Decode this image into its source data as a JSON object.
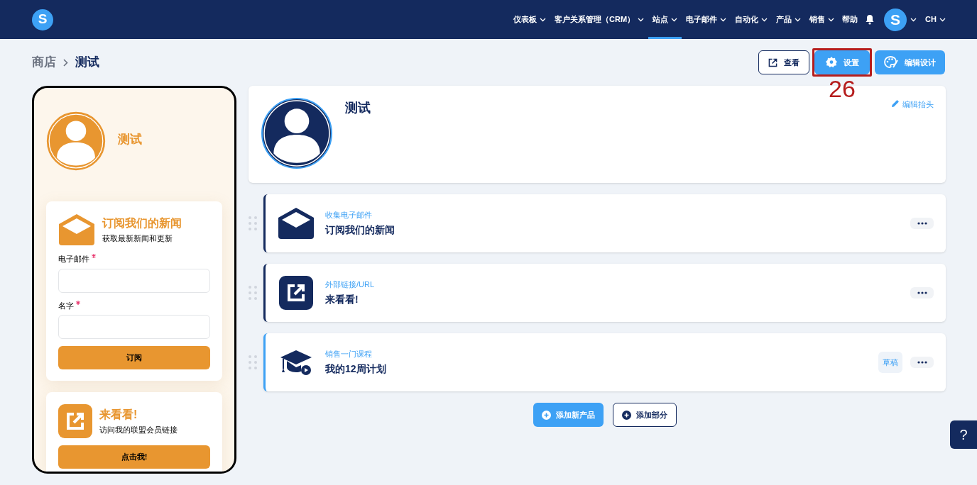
{
  "logo": "S",
  "nav": [
    {
      "label": "仪表板",
      "selected": false
    },
    {
      "label": "客户关系管理（CRM）",
      "selected": false
    },
    {
      "label": "站点",
      "selected": true
    },
    {
      "label": "电子邮件",
      "selected": false
    },
    {
      "label": "自动化",
      "selected": false
    },
    {
      "label": "产品",
      "selected": false
    },
    {
      "label": "销售",
      "selected": false
    }
  ],
  "help_link": "帮助",
  "avatar": "S",
  "language": "CH",
  "breadcrumb": [
    "商店",
    "测试"
  ],
  "actions": [
    {
      "kind": "view",
      "label": "查看"
    },
    {
      "kind": "settings",
      "label": "设置"
    },
    {
      "kind": "design",
      "label": "编辑设计"
    }
  ],
  "annotation": {
    "label": "26"
  },
  "preview": {
    "name": "测试",
    "blocks": [
      {
        "kind": "form",
        "title": "订阅我们的新闻",
        "subtitle": "获取最新新闻和更新",
        "fields": [
          {
            "label": "电子邮件",
            "required": true
          },
          {
            "label": "名字",
            "required": true
          }
        ],
        "button": "订阅"
      },
      {
        "kind": "link",
        "title": "来看看!",
        "subtitle": "访问我的联盟会员链接",
        "button": "点击我!"
      }
    ]
  },
  "header": {
    "title": "测试",
    "edit": "编辑抬头"
  },
  "sections": [
    {
      "kind": "email",
      "type": "收集电子邮件",
      "title": "订阅我们的新闻",
      "draft": false
    },
    {
      "kind": "link",
      "type": "外部链接/URL",
      "title": "来看看!",
      "draft": false
    },
    {
      "kind": "course",
      "type": "销售一门课程",
      "title": "我的12周计划",
      "draft": true,
      "badge": "草稿"
    }
  ],
  "add_buttons": [
    {
      "kind": "primary",
      "label": "添加新产品"
    },
    {
      "kind": "outline",
      "label": "添加部分"
    }
  ],
  "help_button": "?"
}
